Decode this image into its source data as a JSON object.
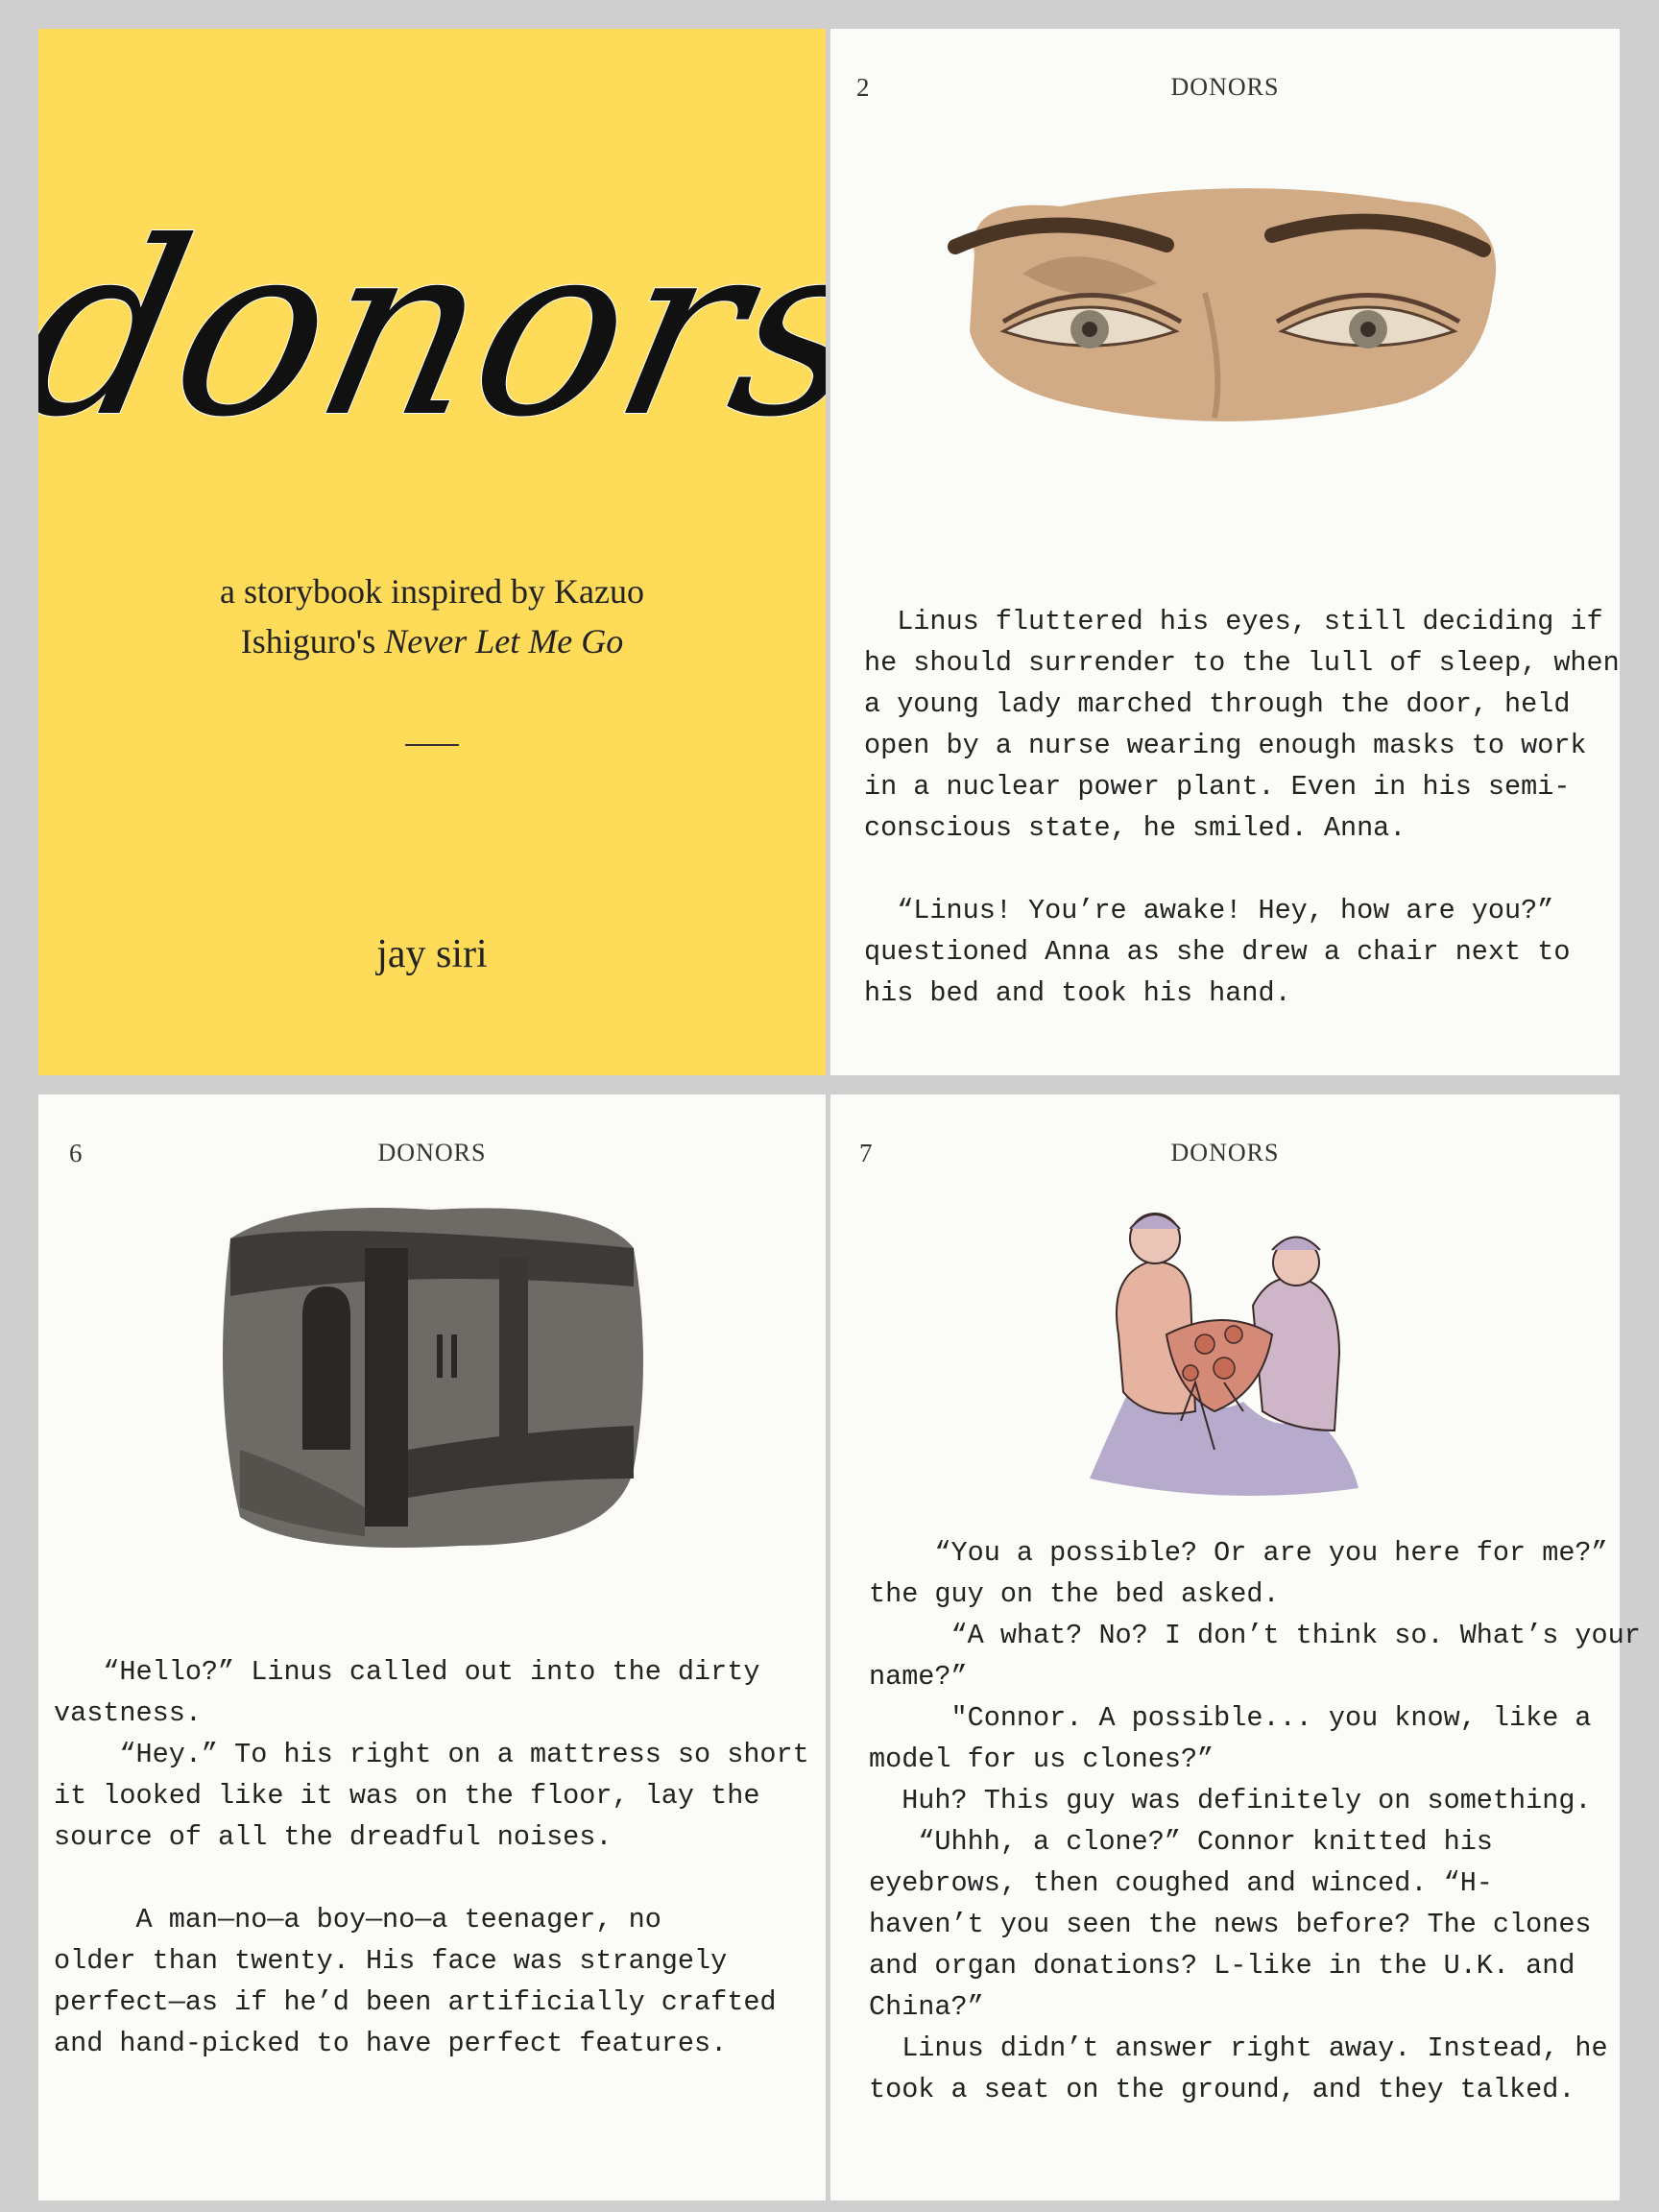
{
  "cover": {
    "title": "donors",
    "subtitle_line1": "a storybook inspired by Kazuo",
    "subtitle_line2_prefix": "Ishiguro's ",
    "subtitle_line2_italic": "Never Let Me Go",
    "author": "jay siri"
  },
  "running_head": "DONORS",
  "pages": {
    "p2": {
      "number": "2",
      "illustration": "eyes-watercolor",
      "text": "  Linus fluttered his eyes, still deciding if\nhe should surrender to the lull of sleep, when\na young lady marched through the door, held\nopen by a nurse wearing enough masks to work\nin a nuclear power plant. Even in his semi-\nconscious state, he smiled. Anna.\n\n  “Linus! You’re awake! Hey, how are you?”\nquestioned Anna as she drew a chair next to\nhis bed and took his hand."
    },
    "p6": {
      "number": "6",
      "illustration": "dark-room-watercolor",
      "text": "   “Hello?” Linus called out into the dirty\nvastness.\n    “Hey.” To his right on a mattress so short\nit looked like it was on the floor, lay the\nsource of all the dreadful noises.\n\n     A man—no—a boy—no—a teenager, no\nolder than twenty. His face was strangely\nperfect—as if he’d been artificially crafted\nand hand-picked to have perfect features."
    },
    "p7": {
      "number": "7",
      "illustration": "surgeons-watercolor",
      "text": "    “You a possible? Or are you here for me?”\nthe guy on the bed asked.\n     “A what? No? I don’t think so. What’s your\nname?”\n     \"Connor. A possible... you know, like a\nmodel for us clones?”\n  Huh? This guy was definitely on something.\n   “Uhhh, a clone?” Connor knitted his\neyebrows, then coughed and winced. “H-\nhaven’t you seen the news before? The clones\nand organ donations? L-like in the U.K. and\nChina?”\n  Linus didn’t answer right away. Instead, he\ntook a seat on the ground, and they talked."
    }
  },
  "colors": {
    "cover_yellow": "#fedc5a",
    "page_white": "#fbfbf8",
    "ink": "#222222",
    "background_gray": "#cfcfcf"
  }
}
